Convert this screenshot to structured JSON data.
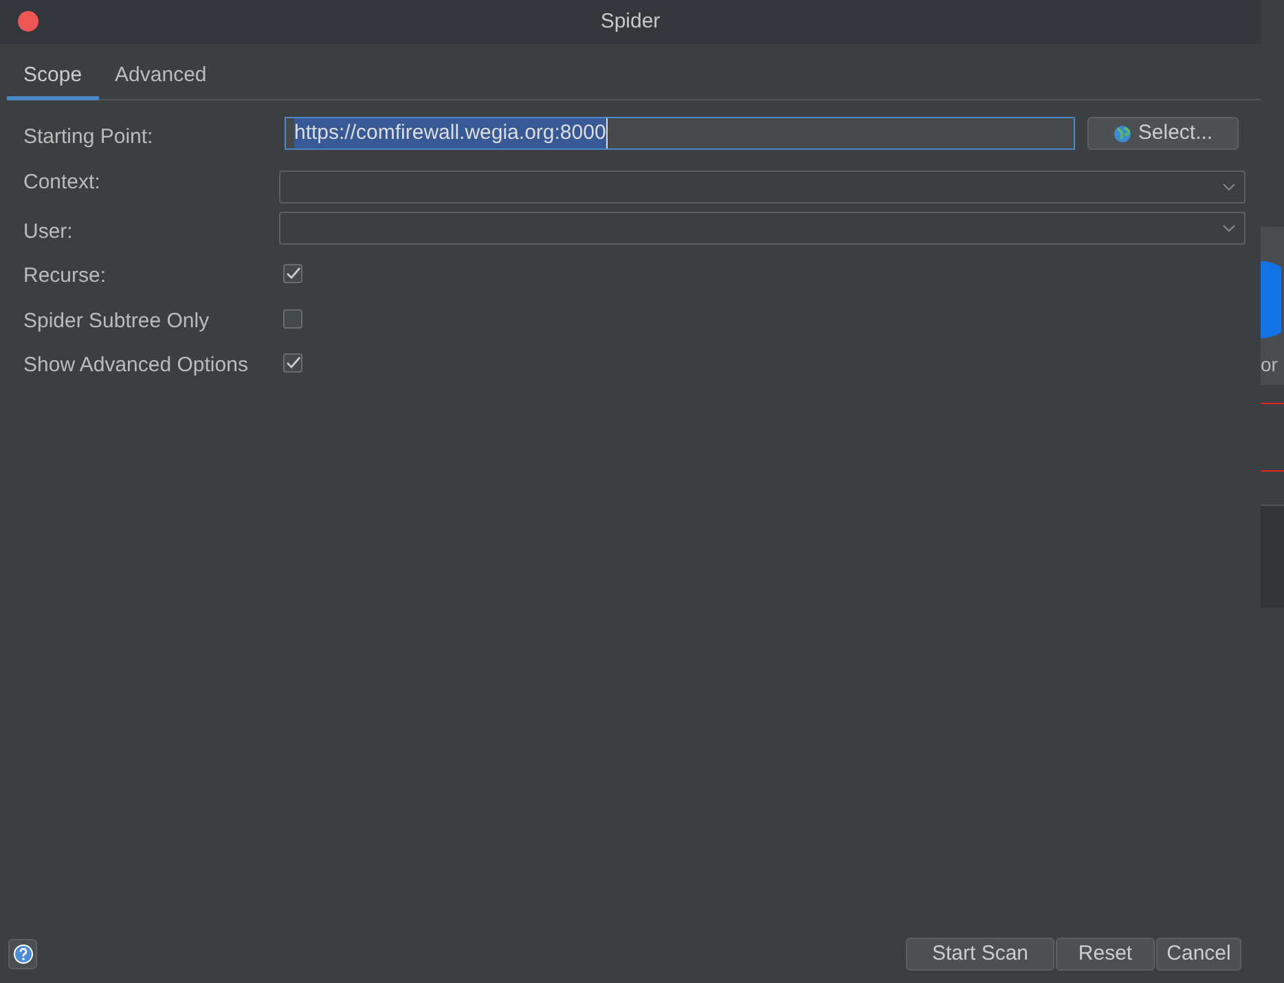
{
  "window": {
    "title": "Spider"
  },
  "tabs": [
    {
      "label": "Scope",
      "selected": true
    },
    {
      "label": "Advanced",
      "selected": false
    }
  ],
  "form": {
    "starting_point": {
      "label": "Starting Point:",
      "value": "https://comfirewall.wegia.org:8000",
      "select_button": "Select..."
    },
    "context": {
      "label": "Context:"
    },
    "user": {
      "label": "User:"
    },
    "options": [
      {
        "label": "Recurse:",
        "checked": true
      },
      {
        "label": "Spider Subtree Only",
        "checked": false
      },
      {
        "label": "Show Advanced Options",
        "checked": true
      }
    ]
  },
  "buttons": [
    "Start Scan",
    "Reset",
    "Cancel"
  ],
  "background_window": {
    "text": "or"
  }
}
